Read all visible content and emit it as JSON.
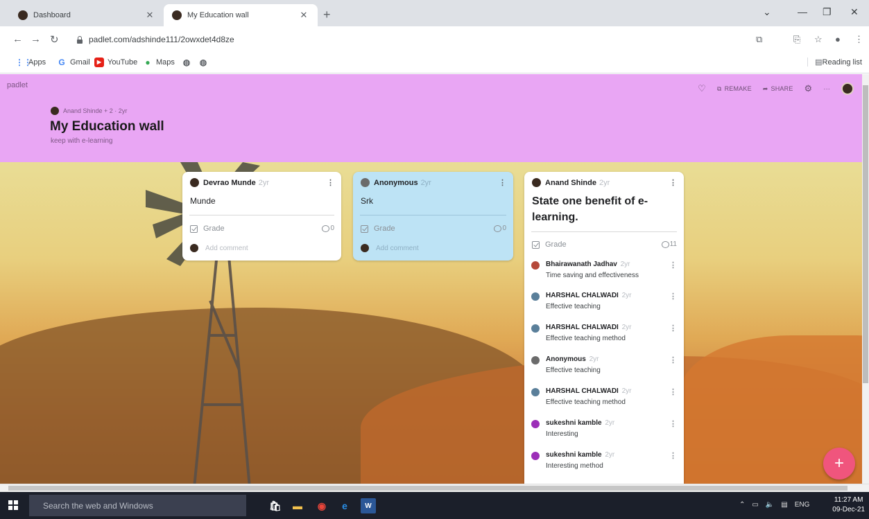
{
  "browser": {
    "tabs": [
      {
        "label": "Dashboard",
        "active": false
      },
      {
        "label": "My Education wall",
        "active": true
      }
    ],
    "url": "padlet.com/adshinde111/2owxdet4d8ze",
    "bookmarks": [
      {
        "label": "Apps",
        "icon": "apps-grid-icon"
      },
      {
        "label": "Gmail",
        "icon": "google-g-icon"
      },
      {
        "label": "YouTube",
        "icon": "youtube-icon"
      },
      {
        "label": "Maps",
        "icon": "maps-pin-icon"
      }
    ],
    "reading_list": "Reading list"
  },
  "padlet": {
    "brand": "padlet",
    "actions": {
      "remake": "REMAKE",
      "share": "SHARE"
    },
    "author_line": "Anand Shinde + 2 · 2yr",
    "title": "My Education wall",
    "subtitle": "keep with e-learning"
  },
  "cards": [
    {
      "author": "Devrao Munde",
      "ago": "2yr",
      "body": "Munde",
      "grade": "Grade",
      "comments": "0",
      "add_comment": "Add comment",
      "color": "#ffffff"
    },
    {
      "author": "Anonymous",
      "ago": "2yr",
      "body": "Srk",
      "grade": "Grade",
      "comments": "0",
      "add_comment": "Add comment",
      "color": "#bde3f5"
    },
    {
      "author": "Anand Shinde",
      "ago": "2yr",
      "body": "State one benefit of e-learning.",
      "grade": "Grade",
      "comments": "11",
      "color": "#ffffff",
      "comment_list": [
        {
          "name": "Bhairawanath Jadhav",
          "ago": "2yr",
          "text": "Time saving and effectiveness",
          "avatar_color": "#b5493a"
        },
        {
          "name": "HARSHAL CHALWADI",
          "ago": "2yr",
          "text": "Effective teaching",
          "avatar_color": "#5a7f9a"
        },
        {
          "name": "HARSHAL CHALWADI",
          "ago": "2yr",
          "text": "Effective teaching method",
          "avatar_color": "#5a7f9a"
        },
        {
          "name": "Anonymous",
          "ago": "2yr",
          "text": "Effective teaching",
          "avatar_color": "#6b6b6b"
        },
        {
          "name": "HARSHAL CHALWADI",
          "ago": "2yr",
          "text": "Effective teaching method",
          "avatar_color": "#5a7f9a"
        },
        {
          "name": "sukeshni kamble",
          "ago": "2yr",
          "text": "Interesting",
          "avatar_color": "#9c2fb8"
        },
        {
          "name": "sukeshni kamble",
          "ago": "2yr",
          "text": "Interesting method",
          "avatar_color": "#9c2fb8"
        }
      ]
    }
  ],
  "fab_label": "+",
  "taskbar": {
    "search_placeholder": "Search the web and Windows",
    "lang": "ENG",
    "time": "11:27 AM",
    "date": "09-Dec-21"
  }
}
